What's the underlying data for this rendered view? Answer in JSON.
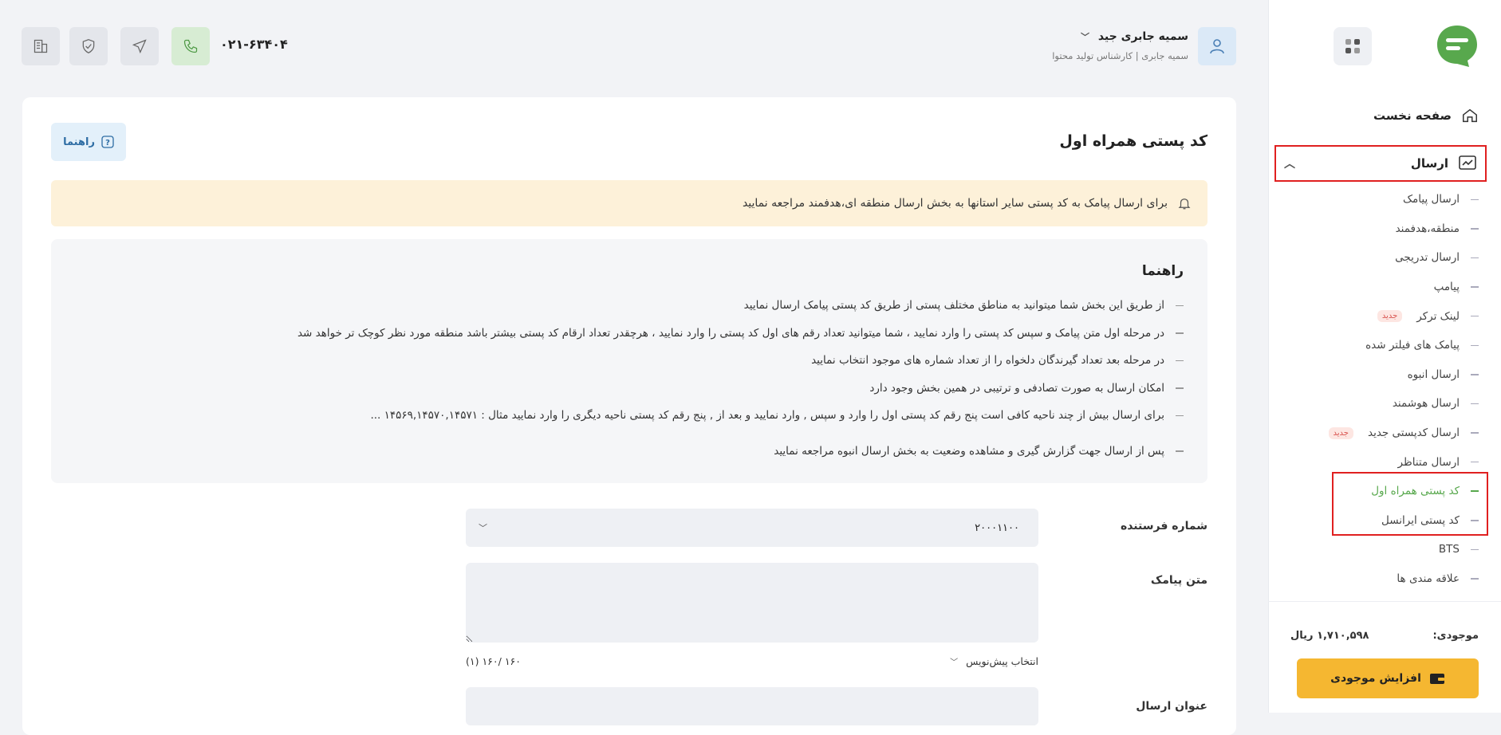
{
  "sidebar": {
    "home_label": "صفحه نخست",
    "send_label": "ارسال",
    "items": [
      {
        "label": "ارسال پیامک",
        "badge": ""
      },
      {
        "label": "منطقه،هدفمند",
        "badge": ""
      },
      {
        "label": "ارسال تدریجی",
        "badge": ""
      },
      {
        "label": "پیامپ",
        "badge": ""
      },
      {
        "label": "لینک ترکر",
        "badge": "جدید"
      },
      {
        "label": "پیامک های فیلتر شده",
        "badge": ""
      },
      {
        "label": "ارسال انبوه",
        "badge": ""
      },
      {
        "label": "ارسال هوشمند",
        "badge": ""
      },
      {
        "label": "ارسال کدپستی جدید",
        "badge": "جدید"
      },
      {
        "label": "ارسال متناظر",
        "badge": ""
      },
      {
        "label": "کد پستی همراه اول",
        "badge": ""
      },
      {
        "label": "کد پستی ایرانسل",
        "badge": ""
      },
      {
        "label": "BTS",
        "badge": ""
      },
      {
        "label": "علاقه مندی ها",
        "badge": ""
      }
    ],
    "balance_label": "موجودی:",
    "balance_value": "۱,۷۱۰,۵۹۸ ریال",
    "charge_button": "افزایش موجودی"
  },
  "header": {
    "user_name": "سمیه جابری جید",
    "user_role": "سمیه جابری | کارشناس تولید محتوا",
    "phone": "۰۲۱-۶۳۴۰۴"
  },
  "main": {
    "title": "کد پستی همراه اول",
    "guide_button": "راهنما",
    "alert_text": "برای ارسال پیامک به کد پستی سایر استانها به بخش ارسال منطقه ای،هدفمند مراجعه نمایید",
    "guide_title": "راهنما",
    "guide_items": [
      "از طریق این بخش شما میتوانید به مناطق مختلف پستی از طریق کد پستی پیامک ارسال نمایید",
      "در مرحله اول متن پیامک و سپس کد پستی را وارد نمایید ، شما میتوانید تعداد رقم های اول کد پستی را وارد نمایید ، هرچقدر تعداد ارقام کد پستی بیشتر باشد منطقه مورد نظر کوچک تر خواهد شد",
      "در مرحله بعد تعداد گیرندگان دلخواه را از تعداد شماره های موجود انتخاب نمایید",
      "امکان ارسال به صورت تصادفی و ترتیبی در همین بخش وجود دارد",
      "برای ارسال بیش از چند ناحیه کافی است پنج رقم کد پستی اول را وارد و سپس , وارد نمایید و بعد از , پنج رقم کد پستی ناحیه دیگری را وارد نمایید مثال : ۱۴۵۶۹,۱۴۵۷۰,۱۴۵۷۱ ...",
      "پس از ارسال جهت گزارش گیری و مشاهده وضعیت به بخش ارسال انبوه مراجعه نمایید"
    ],
    "sender_label": "شماره فرستنده",
    "sender_value": "۲۰۰۰۱۱۰۰",
    "sms_label": "متن پیامک",
    "draft_label": "انتخاب پیش‌نویس",
    "char_count": "۱۶۰ /۱۶۰ (۱)",
    "send_title_label": "عنوان ارسال"
  },
  "colors": {
    "accent_green": "#58a84d",
    "charge_yellow": "#f5b731",
    "highlight_red": "#e02020"
  }
}
